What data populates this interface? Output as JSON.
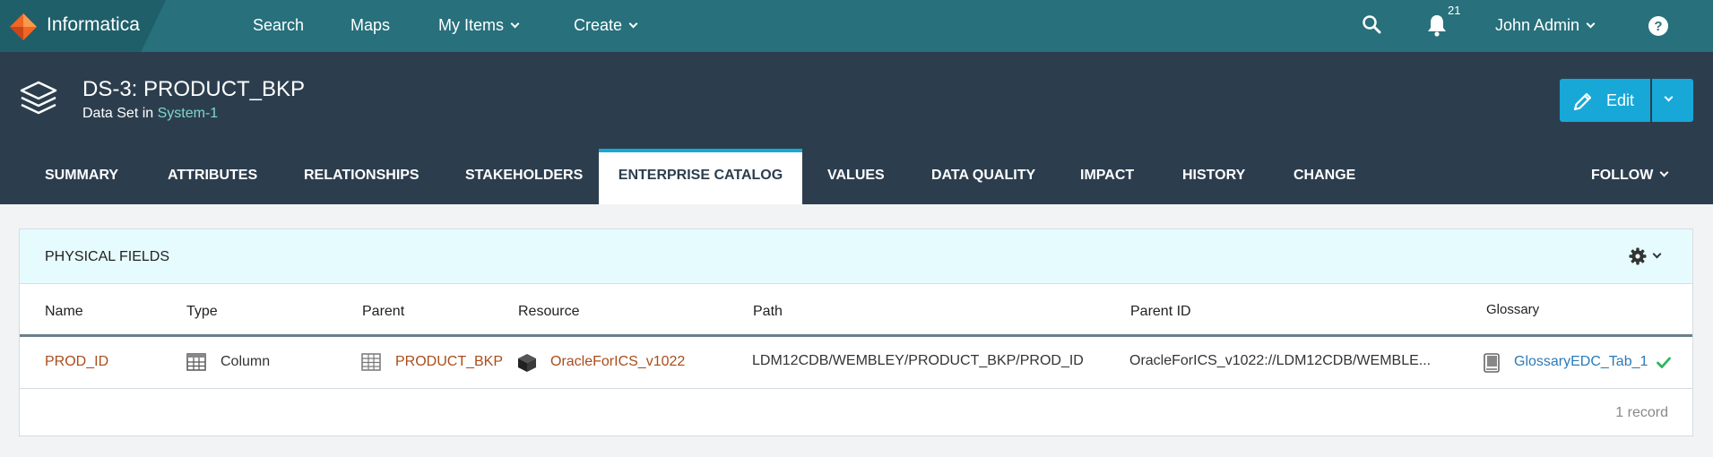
{
  "app": {
    "name": "Informatica"
  },
  "nav": {
    "search": "Search",
    "maps": "Maps",
    "my_items": "My Items",
    "create": "Create",
    "notification_count": "21",
    "user": "John Admin"
  },
  "header": {
    "title": "DS-3: PRODUCT_BKP",
    "subtitle_prefix": "Data Set in",
    "subtitle_link": "System-1",
    "edit_label": "Edit"
  },
  "tabs": [
    {
      "label": "SUMMARY"
    },
    {
      "label": "ATTRIBUTES"
    },
    {
      "label": "RELATIONSHIPS"
    },
    {
      "label": "STAKEHOLDERS"
    },
    {
      "label": "ENTERPRISE CATALOG",
      "active": true
    },
    {
      "label": "VALUES"
    },
    {
      "label": "DATA QUALITY"
    },
    {
      "label": "IMPACT"
    },
    {
      "label": "HISTORY"
    },
    {
      "label": "CHANGE"
    }
  ],
  "follow_label": "FOLLOW",
  "panel": {
    "title": "PHYSICAL FIELDS",
    "columns": [
      "Name",
      "Type",
      "Parent",
      "Resource",
      "Path",
      "Parent ID",
      "Glossary"
    ],
    "rows": [
      {
        "name": "PROD_ID",
        "type": "Column",
        "parent": "PRODUCT_BKP",
        "resource": "OracleForICS_v1022",
        "path": "LDM12CDB/WEMBLEY/PRODUCT_BKP/PROD_ID",
        "parent_id": "OracleForICS_v1022://LDM12CDB/WEMBLE...",
        "glossary": "GlossaryEDC_Tab_1"
      }
    ],
    "record_count": "1 record"
  },
  "colors": {
    "topbar": "#27707c",
    "header": "#2c3e4e",
    "accent": "#17a8d8",
    "link": "#a94d1b",
    "panel_head": "#e6fbfd"
  }
}
